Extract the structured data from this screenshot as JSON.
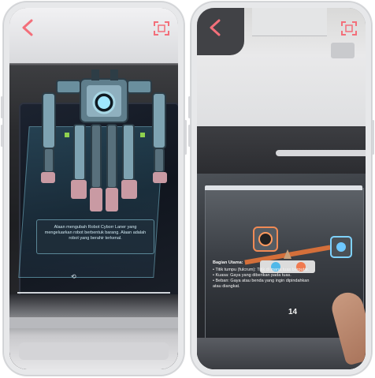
{
  "app": {
    "accent_color": "#f36f7a"
  },
  "left_phone": {
    "toolbar": {
      "back_icon": "chevron-left-icon",
      "ar_icon": "ar-scan-icon"
    },
    "description": "Alaan mengubah Robot Cyborr Laner yang mengeluarkan robot berbentuk barang. Alaan adalah robot yang berahir terkenal."
  },
  "right_phone": {
    "toolbar": {
      "back_icon": "chevron-left-icon",
      "ar_icon": "ar-scan-icon"
    },
    "book": {
      "section_title": "Bagian Utama:",
      "bullets": [
        "Titik tumpu (fulcrum): Titik di mana tuas berputar.",
        "Kuasa: Gaya yang diberikan pada tuas.",
        "Beban: Gaya atau benda yang ingin dipindahkan atau diangkat."
      ],
      "page_number": "14"
    }
  }
}
